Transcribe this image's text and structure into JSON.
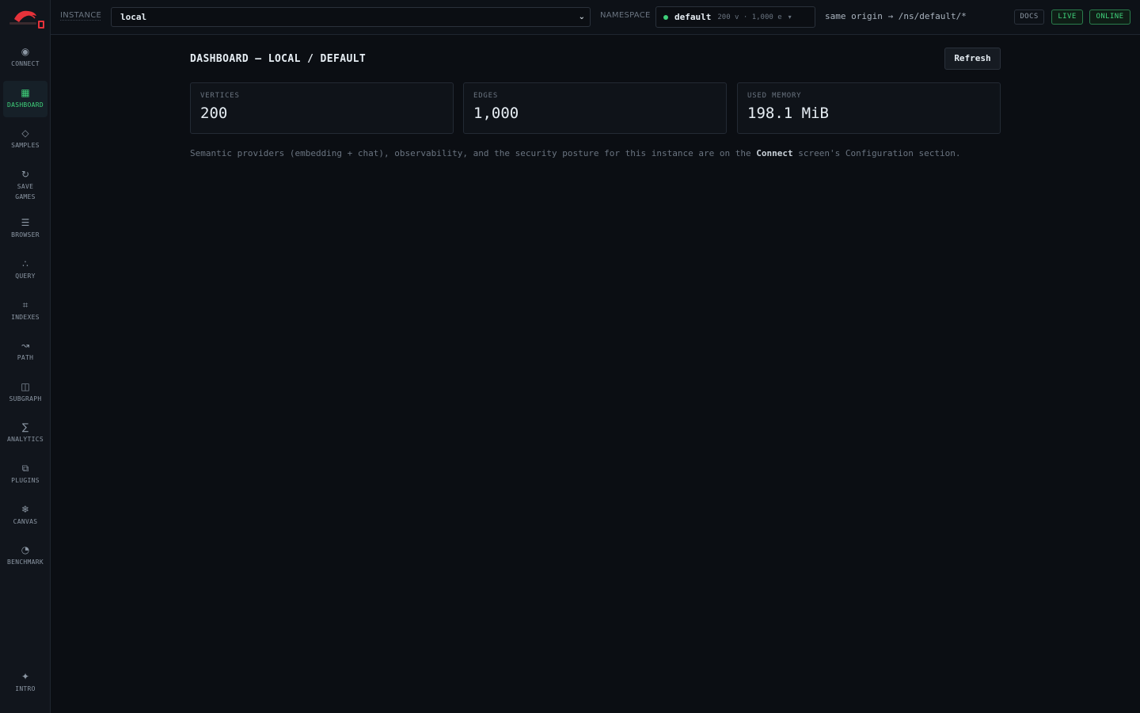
{
  "app": {
    "brand_colors": {
      "accent": "#3fd07a",
      "logo_red": "#e5323a"
    }
  },
  "sidebar": {
    "items": [
      {
        "key": "connect",
        "label": "CONNECT",
        "icon": "target-icon",
        "glyph": "◉",
        "active": false
      },
      {
        "key": "dashboard",
        "label": "DASHBOARD",
        "icon": "dashboard-icon",
        "glyph": "▦",
        "active": true
      },
      {
        "key": "samples",
        "label": "SAMPLES",
        "icon": "diamond-icon",
        "glyph": "◇",
        "active": false
      },
      {
        "key": "save-games",
        "label": "SAVE\nGAMES",
        "icon": "refresh-icon",
        "glyph": "↻",
        "active": false
      },
      {
        "key": "browser",
        "label": "BROWSER",
        "icon": "list-icon",
        "glyph": "☰",
        "active": false
      },
      {
        "key": "query",
        "label": "QUERY",
        "icon": "dots-icon",
        "glyph": "∴",
        "active": false
      },
      {
        "key": "indexes",
        "label": "INDEXES",
        "icon": "grid-icon",
        "glyph": "⌗",
        "active": false
      },
      {
        "key": "path",
        "label": "PATH",
        "icon": "wave-icon",
        "glyph": "↝",
        "active": false
      },
      {
        "key": "subgraph",
        "label": "SUBGRAPH",
        "icon": "square-icon",
        "glyph": "◫",
        "active": false
      },
      {
        "key": "analytics",
        "label": "ANALYTICS",
        "icon": "sigma-icon",
        "glyph": "∑",
        "active": false
      },
      {
        "key": "plugins",
        "label": "PLUGINS",
        "icon": "plugin-icon",
        "glyph": "⧉",
        "active": false
      },
      {
        "key": "canvas",
        "label": "CANVAS",
        "icon": "snowflake-icon",
        "glyph": "❄",
        "active": false
      },
      {
        "key": "benchmark",
        "label": "BENCHMARK",
        "icon": "gauge-icon",
        "glyph": "◔",
        "active": false
      }
    ],
    "bottom": {
      "label": "INTRO",
      "icon": "sparkle-icon",
      "glyph": "✦"
    }
  },
  "topbar": {
    "instance_label": "INSTANCE",
    "instance_value": "local",
    "instance_chevron": "⌄",
    "namespace_label": "NAMESPACE",
    "namespace_name": "default",
    "namespace_meta": "200 v · 1,000 e",
    "namespace_caret": "▾",
    "origin": "same origin → /ns/default/*",
    "docs": "DOCS",
    "live": "LIVE",
    "status": "ONLINE"
  },
  "main": {
    "title": "DASHBOARD — LOCAL / DEFAULT",
    "refresh": "Refresh",
    "cards": [
      {
        "label": "VERTICES",
        "value": "200"
      },
      {
        "label": "EDGES",
        "value": "1,000"
      },
      {
        "label": "USED MEMORY",
        "value": "198.1 MiB"
      }
    ],
    "note_before": "Semantic providers (embedding + chat), observability, and the security posture for this instance are on the ",
    "note_link": "Connect",
    "note_after": " screen's Configuration section."
  }
}
